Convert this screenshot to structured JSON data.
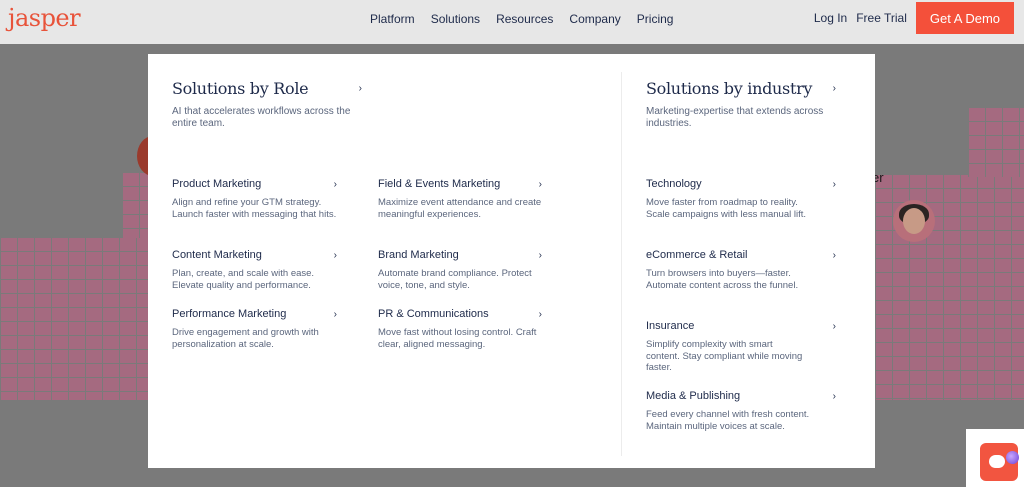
{
  "brand": {
    "logo_text": "jasper",
    "accent_color": "#f4503a"
  },
  "nav": {
    "links": [
      "Platform",
      "Solutions",
      "Resources",
      "Company",
      "Pricing"
    ],
    "login_label": "Log In",
    "free_trial_label": "Free Trial",
    "demo_label": "Get A Demo"
  },
  "hero": {
    "partial_label": "er"
  },
  "menu": {
    "by_role": {
      "title": "Solutions by Role",
      "description": "AI that accelerates workflows across the entire team.",
      "items": [
        {
          "title": "Product Marketing",
          "description": "Align and refine your GTM strategy. Launch faster with messaging that hits."
        },
        {
          "title": "Field & Events Marketing",
          "description": "Maximize event attendance and create meaningful experiences."
        },
        {
          "title": "Content Marketing",
          "description": "Plan, create, and scale with ease. Elevate quality and performance."
        },
        {
          "title": "Brand Marketing",
          "description": "Automate brand compliance. Protect voice, tone, and style."
        },
        {
          "title": "Performance Marketing",
          "description": "Drive engagement and growth with personalization at scale."
        },
        {
          "title": "PR & Communications",
          "description": "Move fast without losing control. Craft clear, aligned messaging."
        }
      ]
    },
    "by_industry": {
      "title": "Solutions by industry",
      "description": "Marketing-expertise that extends across industries.",
      "items": [
        {
          "title": "Technology",
          "description": "Move faster from roadmap to reality. Scale campaigns with less manual lift."
        },
        {
          "title": "eCommerce & Retail",
          "description": "Turn browsers into buyers—faster. Automate content across the funnel."
        },
        {
          "title": "Insurance",
          "description": "Simplify complexity with smart content. Stay compliant while moving faster."
        },
        {
          "title": "Media & Publishing",
          "description": "Feed every channel with fresh content. Maintain multiple voices at scale."
        }
      ]
    }
  },
  "icons": {
    "chevron": "chevron-right-icon",
    "chat": "chat-icon"
  }
}
